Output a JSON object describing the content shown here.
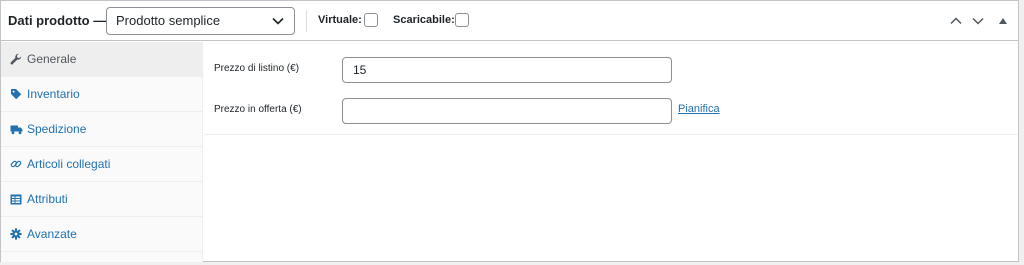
{
  "header": {
    "title": "Dati prodotto —",
    "product_type": {
      "selected": "Prodotto semplice",
      "icon": "chevron-down-icon"
    },
    "options": {
      "virtual_label": "Virtuale:",
      "virtual_checked": false,
      "downloadable_label": "Scaricabile:",
      "downloadable_checked": false
    },
    "controls": {
      "move_up_icon": "chevron-up-icon",
      "move_down_icon": "chevron-down-icon",
      "toggle_icon": "triangle-up-icon"
    }
  },
  "sidebar": {
    "items": [
      {
        "label": "Generale",
        "icon": "wrench-icon",
        "active": true
      },
      {
        "label": "Inventario",
        "icon": "tag-icon",
        "active": false
      },
      {
        "label": "Spedizione",
        "icon": "truck-icon",
        "active": false
      },
      {
        "label": "Articoli collegati",
        "icon": "link-icon",
        "active": false
      },
      {
        "label": "Attributi",
        "icon": "table-icon",
        "active": false
      },
      {
        "label": "Avanzate",
        "icon": "gear-icon",
        "active": false
      }
    ]
  },
  "general": {
    "regular_price": {
      "label": "Prezzo di listino (€)",
      "value": "15"
    },
    "sale_price": {
      "label": "Prezzo in offerta (€)",
      "value": "",
      "schedule_link": "Pianifica"
    }
  },
  "colors": {
    "link": "#2271b1",
    "text": "#1d2327",
    "border": "#c3c4c7",
    "active_tab_bg": "#eeeeee",
    "sidebar_bg": "#fafafa"
  }
}
